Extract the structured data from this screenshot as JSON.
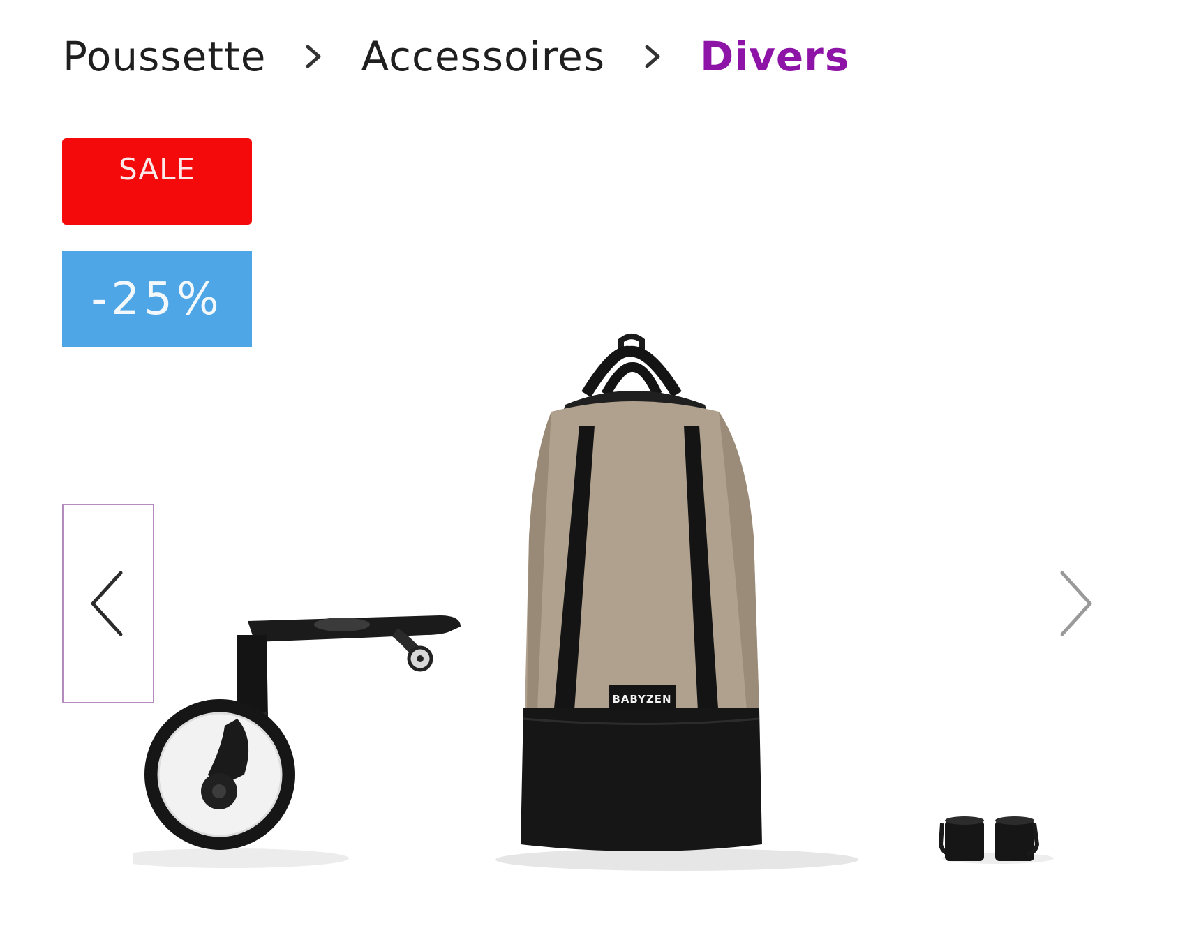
{
  "breadcrumb": {
    "items": [
      {
        "label": "Poussette"
      },
      {
        "label": "Accessoires"
      },
      {
        "label": "Divers"
      }
    ]
  },
  "badges": {
    "sale": "SALE",
    "discount": "-25%"
  },
  "product": {
    "brand_logo": "BABYZEN"
  },
  "icons": {
    "breadcrumb_separator": "chevron-right-icon",
    "prev": "chevron-left-icon",
    "next": "chevron-right-icon"
  },
  "colors": {
    "current_crumb": "#8e14a8",
    "sale_badge": "#f40a0a",
    "discount_badge": "#4ea6e6"
  }
}
